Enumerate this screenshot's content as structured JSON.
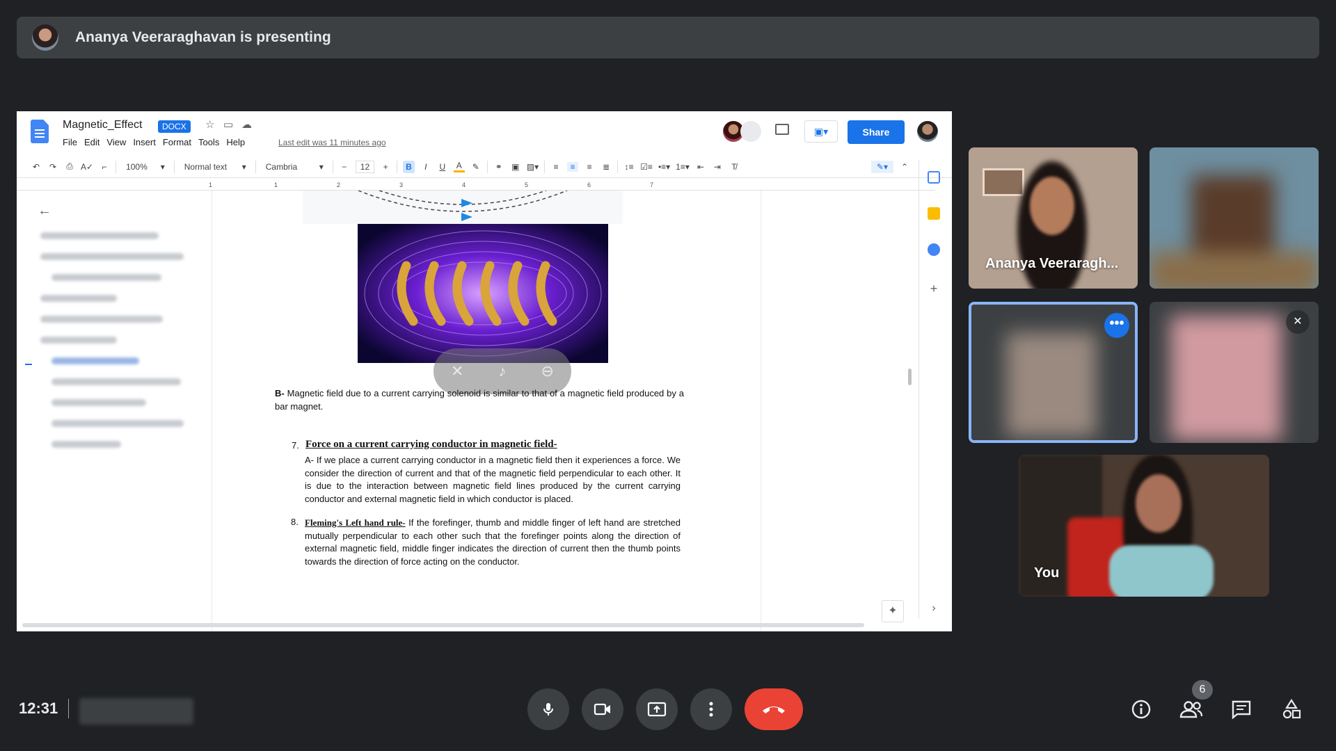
{
  "banner": {
    "text": "Ananya Veeraraghavan is presenting"
  },
  "document": {
    "title": "Magnetic_Effect",
    "badge": "DOCX",
    "menu": [
      "File",
      "Edit",
      "View",
      "Insert",
      "Format",
      "Tools",
      "Help"
    ],
    "last_edit": "Last edit was 11 minutes ago",
    "share_label": "Share",
    "toolbar": {
      "zoom": "100%",
      "style": "Normal text",
      "font": "Cambria",
      "font_size": "12"
    },
    "ruler_ticks": [
      "1",
      "1",
      "2",
      "3",
      "4",
      "5",
      "6",
      "7"
    ],
    "body": {
      "para_b_label": "B-",
      "para_b": "Magnetic field due to a current carrying solenoid is similar to that of a magnetic field produced by a bar magnet.",
      "item7_num": "7.",
      "item7_heading": "Force on a current carrying conductor in magnetic field-",
      "item7_text": "A- If we place a current carrying conductor in a magnetic field then it experiences a force. We consider the direction of current and that of the magnetic field perpendicular to each other.  It is due to the interaction between magnetic field lines produced by the current carrying conductor and external magnetic field in which conductor is placed.",
      "item8_num": "8.",
      "item8_heading": "Fleming's Left hand rule-",
      "item8_text": " If the forefinger, thumb and middle finger of left hand are stretched mutually perpendicular to each other such that the forefinger points along the direction of external magnetic field, middle finger indicates the direction of current then the thumb points towards the direction of force acting on the conductor."
    }
  },
  "participants": [
    {
      "name": "Ananya Veeraragh..."
    },
    {
      "name": "You"
    }
  ],
  "bottom_bar": {
    "time": "12:31",
    "participant_count": "6"
  },
  "colors": {
    "background": "#202124",
    "surface": "#3c4043",
    "accent": "#1a73e8",
    "end_call": "#ea4335"
  }
}
